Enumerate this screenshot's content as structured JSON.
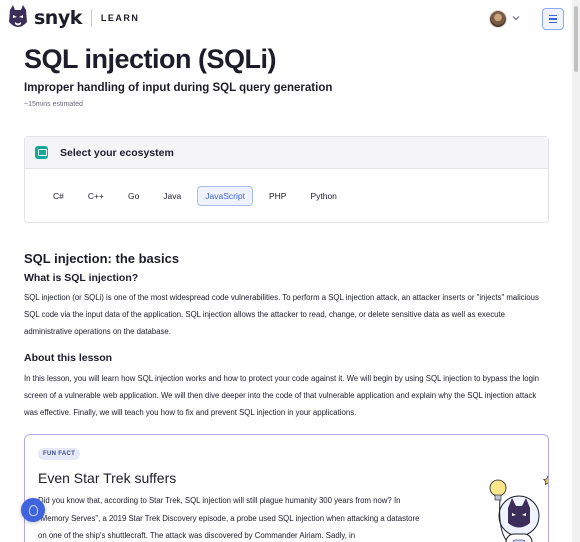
{
  "header": {
    "brand": "snyk",
    "section": "LEARN"
  },
  "lesson": {
    "title": "SQL injection (SQLi)",
    "subtitle": "Improper handling of input during SQL query generation",
    "estimate": "~15mins estimated"
  },
  "ecosystem": {
    "heading": "Select your ecosystem",
    "tabs": [
      {
        "label": "C#"
      },
      {
        "label": "C++"
      },
      {
        "label": "Go"
      },
      {
        "label": "Java"
      },
      {
        "label": "JavaScript"
      },
      {
        "label": "PHP"
      },
      {
        "label": "Python"
      }
    ],
    "selected": "JavaScript"
  },
  "basics": {
    "heading": "SQL injection: the basics",
    "what_heading": "What is SQL injection?",
    "what_text": "SQL injection (or SQLi) is one of the most widespread code vulnerabilities. To perform a SQL injection attack, an attacker inserts or \"injects\" malicious SQL code via the input data of the application. SQL injection allows the attacker to read, change, or delete sensitive data as well as execute administrative operations on the database.",
    "about_heading": "About this lesson",
    "about_text": "In this lesson, you will learn how SQL injection works and how to protect your code against it. We will begin by using SQL injection to bypass the login screen of a vulnerable web application. We will then dive deeper into the code of that vulnerable application and explain why the SQL injection attack was effective. Finally, we will teach you how to fix and prevent SQL injection in your applications."
  },
  "fun_fact": {
    "badge": "FUN FACT",
    "title": "Even Star Trek suffers",
    "text": "Did you know that, according to Star Trek, SQL injection will still plague humanity 300 years from now? In \"Memory Serves\", a 2019 Star Trek Discovery episode, a probe used SQL injection when attacking a datastore on one of the ship's shuttlecraft. The attack was discovered by Commander Airiam. Sadly, in"
  },
  "colors": {
    "accent": "#3e63dd",
    "eco_icon": "#13a89e",
    "fun_border": "#b8a8e8"
  },
  "icons": [
    "snyk-logo-icon",
    "chevron-down-icon",
    "menu-icon",
    "ecosystem-icon",
    "astronaut-illustration",
    "help-icon"
  ]
}
